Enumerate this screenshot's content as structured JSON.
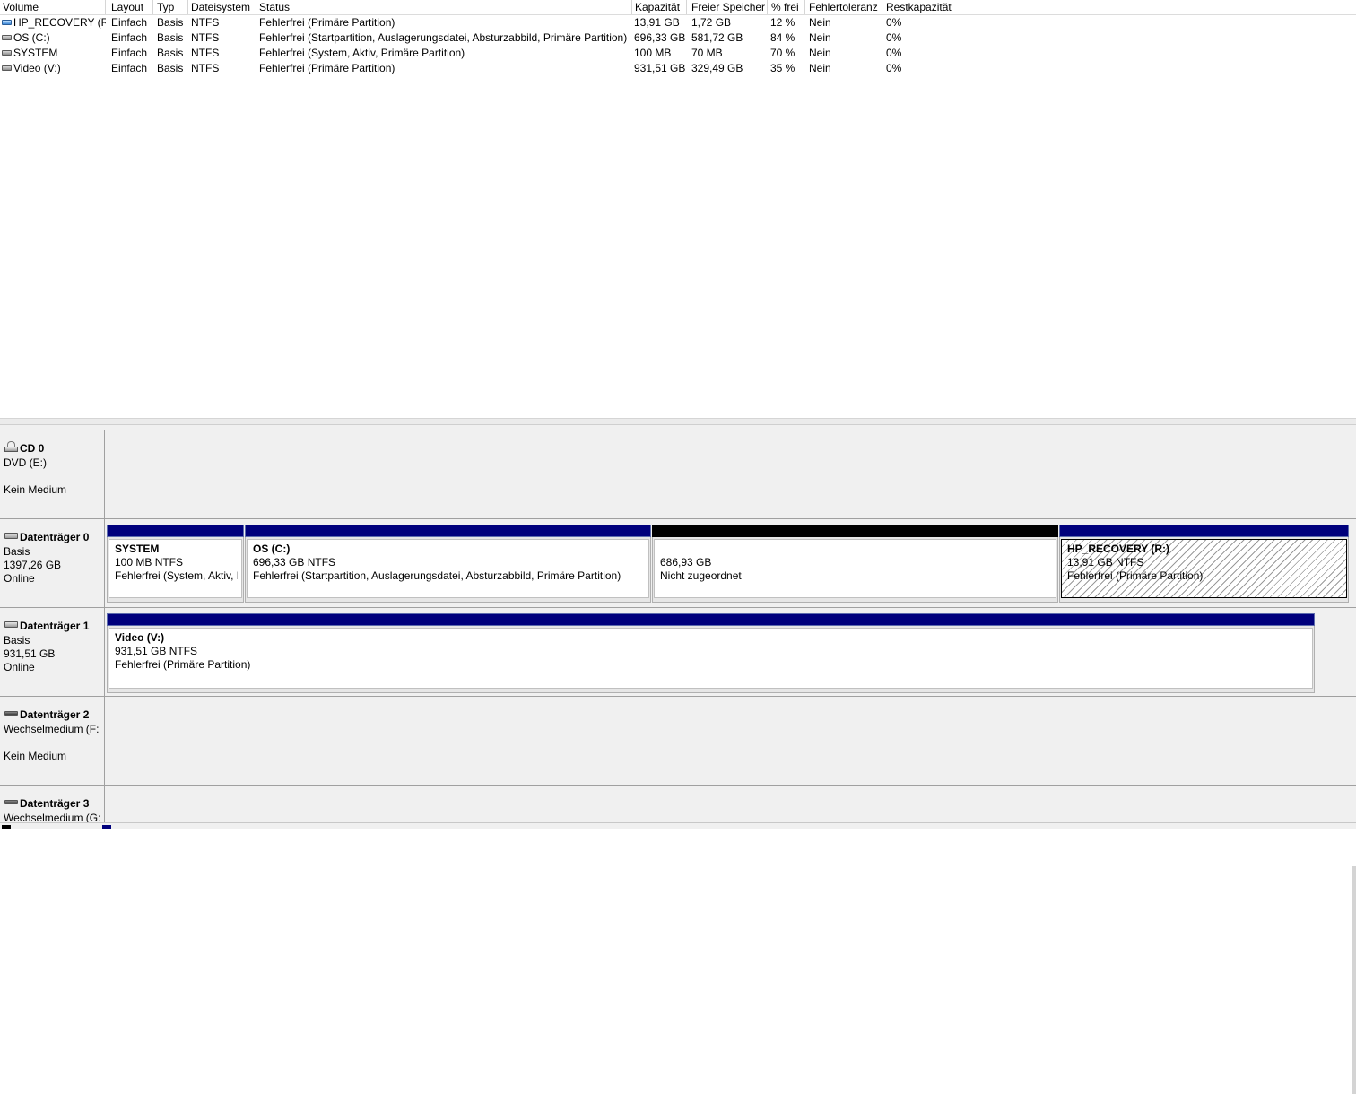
{
  "columns": [
    "Volume",
    "Layout",
    "Typ",
    "Dateisystem",
    "Status",
    "Kapazität",
    "Freier Speicher",
    "% frei",
    "Fehlertoleranz",
    "Restkapazität"
  ],
  "volumes": [
    {
      "icon": "recovery-volume-icon",
      "name": "HP_RECOVERY (R:)",
      "layout": "Einfach",
      "type": "Basis",
      "fs": "NTFS",
      "status": "Fehlerfrei (Primäre Partition)",
      "capacity": "13,91 GB",
      "free": "1,72 GB",
      "pct_free": "12 %",
      "fault_tolerance": "Nein",
      "overhead": "0%"
    },
    {
      "icon": "volume-icon",
      "name": "OS (C:)",
      "layout": "Einfach",
      "type": "Basis",
      "fs": "NTFS",
      "status": "Fehlerfrei (Startpartition, Auslagerungsdatei, Absturzabbild, Primäre Partition)",
      "capacity": "696,33 GB",
      "free": "581,72 GB",
      "pct_free": "84 %",
      "fault_tolerance": "Nein",
      "overhead": "0%"
    },
    {
      "icon": "volume-icon",
      "name": "SYSTEM",
      "layout": "Einfach",
      "type": "Basis",
      "fs": "NTFS",
      "status": "Fehlerfrei (System, Aktiv, Primäre Partition)",
      "capacity": "100 MB",
      "free": "70 MB",
      "pct_free": "70 %",
      "fault_tolerance": "Nein",
      "overhead": "0%"
    },
    {
      "icon": "volume-icon",
      "name": "Video (V:)",
      "layout": "Einfach",
      "type": "Basis",
      "fs": "NTFS",
      "status": "Fehlerfrei (Primäre Partition)",
      "capacity": "931,51 GB",
      "free": "329,49 GB",
      "pct_free": "35 %",
      "fault_tolerance": "Nein",
      "overhead": "0%"
    }
  ],
  "disks": [
    {
      "name": "CD 0",
      "lines": [
        "DVD (E:)",
        "",
        "Kein Medium"
      ],
      "icon": "cd-drive-icon"
    },
    {
      "name": "Datenträger 0",
      "lines": [
        "Basis",
        "1397,26 GB",
        "Online"
      ],
      "icon": "disk-icon",
      "partitions": [
        {
          "name": "SYSTEM",
          "size": "100 MB NTFS",
          "status": "Fehlerfrei (System, Aktiv, P"
        },
        {
          "name": "OS  (C:)",
          "size": "696,33 GB NTFS",
          "status": "Fehlerfrei (Startpartition, Auslagerungsdatei, Absturzabbild, Primäre Partition)"
        },
        {
          "name": "",
          "size": "686,93 GB",
          "status": "Nicht zugeordnet"
        },
        {
          "name": "HP_RECOVERY  (R:)",
          "size": "13,91 GB NTFS",
          "status": "Fehlerfrei (Primäre Partition)"
        }
      ]
    },
    {
      "name": "Datenträger 1",
      "lines": [
        "Basis",
        "931,51 GB",
        "Online"
      ],
      "icon": "disk-icon",
      "partitions": [
        {
          "name": "Video  (V:)",
          "size": "931,51 GB NTFS",
          "status": "Fehlerfrei (Primäre Partition)"
        }
      ]
    },
    {
      "name": "Datenträger 2",
      "lines": [
        "Wechselmedium (F:",
        "",
        "Kein Medium"
      ],
      "icon": "removable-disk-icon"
    },
    {
      "name": "Datenträger 3",
      "lines": [
        "Wechselmedium (G:"
      ],
      "icon": "removable-disk-icon"
    }
  ],
  "colors": {
    "primary_partition": "#00007c",
    "unallocated": "#000000",
    "background": "#f0f0f0"
  }
}
